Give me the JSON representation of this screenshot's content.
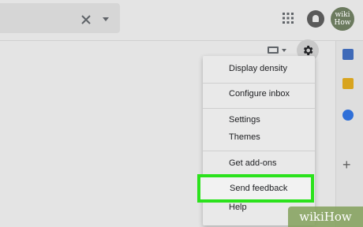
{
  "header": {
    "avatar_text": "wiki How"
  },
  "menu": {
    "items": [
      {
        "label": "Display density"
      },
      {
        "label": "Configure inbox"
      },
      {
        "label": "Settings"
      },
      {
        "label": "Themes"
      },
      {
        "label": "Get add-ons"
      },
      {
        "label": "Send feedback"
      },
      {
        "label": "Help"
      }
    ]
  },
  "watermark": {
    "text": "wikiHow"
  },
  "colors": {
    "highlight": "#2be21c",
    "background": "#e4e4e4",
    "menu_background": "#e9e9e9"
  },
  "icons": [
    "clear-icon",
    "dropdown-icon",
    "apps-icon",
    "notifications-icon",
    "keyboard-icon",
    "gear-icon",
    "calendar-icon",
    "keep-icon",
    "tasks-icon",
    "add-icon"
  ]
}
